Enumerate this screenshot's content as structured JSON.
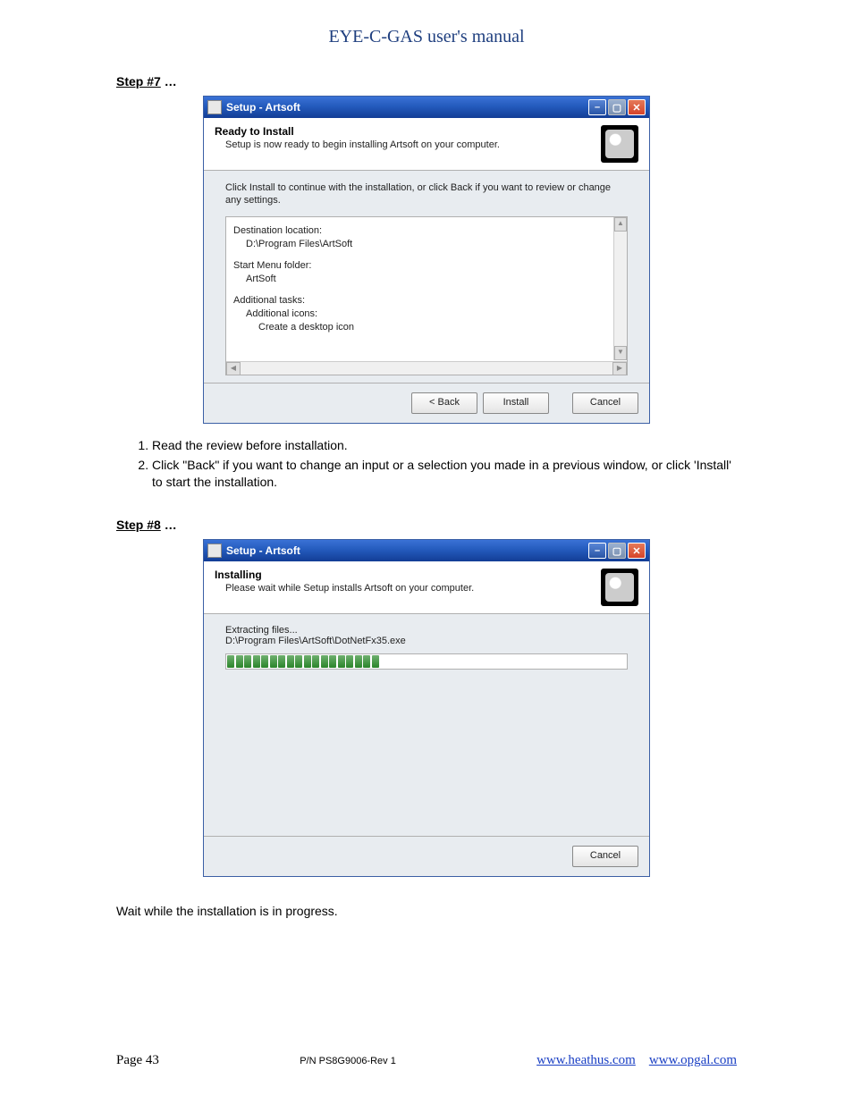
{
  "doc_header": "EYE-C-GAS user's manual",
  "step7": {
    "heading": "Step #7",
    "dots": "…",
    "window_title": "Setup - Artsoft",
    "wizard_title": "Ready to Install",
    "wizard_subtitle": "Setup is now ready to begin installing Artsoft on your computer.",
    "body_note": "Click Install to continue with the installation, or click Back if you want to review or change any settings.",
    "summary": {
      "dest_label": "Destination location:",
      "dest_value": "D:\\Program Files\\ArtSoft",
      "startmenu_label": "Start Menu folder:",
      "startmenu_value": "ArtSoft",
      "tasks_label": "Additional tasks:",
      "tasks_sub": "Additional icons:",
      "tasks_item": "Create a desktop icon"
    },
    "btn_back": "< Back",
    "btn_install": "Install",
    "btn_cancel": "Cancel",
    "instructions": [
      "Read the review before installation.",
      "Click \"Back\" if you want to change an input or a selection you made in a previous window, or click 'Install' to start the installation."
    ]
  },
  "step8": {
    "heading": "Step #8",
    "dots": "…",
    "window_title": "Setup - Artsoft",
    "wizard_title": "Installing",
    "wizard_subtitle": "Please wait while Setup installs Artsoft on your computer.",
    "extract_label": "Extracting files...",
    "extract_path": "D:\\Program Files\\ArtSoft\\DotNetFx35.exe",
    "progress_blocks": 18,
    "btn_cancel": "Cancel",
    "wait_text": "Wait while the installation is in progress."
  },
  "footer": {
    "page": "Page 43",
    "pn": "P/N PS8G9006-Rev 1",
    "link1": "www.heathus.com",
    "link2": "www.opgal.com"
  },
  "win_controls": {
    "min": "–",
    "max": "▢",
    "close": "✕"
  },
  "scroll_glyphs": {
    "up": "▲",
    "down": "▼",
    "left": "◀",
    "right": "▶"
  }
}
